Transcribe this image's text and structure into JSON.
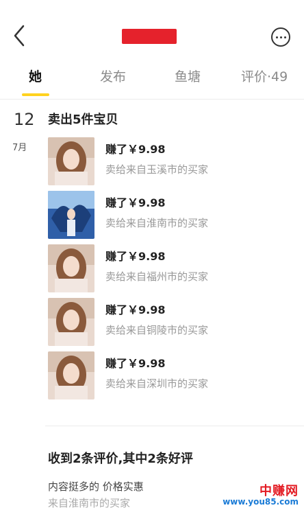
{
  "header": {
    "title_redacted": true
  },
  "tabs": [
    {
      "label": "她",
      "active": true
    },
    {
      "label": "发布"
    },
    {
      "label": "鱼塘"
    },
    {
      "label": "评价·49"
    }
  ],
  "timeline": {
    "day": "12",
    "month": "7月",
    "title": "卖出5件宝贝",
    "sales": [
      {
        "earned": "赚了￥9.98",
        "buyer": "卖给来自玉溪市的买家",
        "thumb": "portrait"
      },
      {
        "earned": "赚了￥9.98",
        "buyer": "卖给来自淮南市的买家",
        "thumb": "blue-anime"
      },
      {
        "earned": "赚了￥9.98",
        "buyer": "卖给来自福州市的买家",
        "thumb": "portrait"
      },
      {
        "earned": "赚了￥9.98",
        "buyer": "卖给来自铜陵市的买家",
        "thumb": "portrait"
      },
      {
        "earned": "赚了￥9.98",
        "buyer": "卖给来自深圳市的买家",
        "thumb": "portrait"
      }
    ]
  },
  "reviews": {
    "title": "收到2条评价,其中2条好评",
    "text": "内容挺多的 价格实惠",
    "source": "来自淮南市的买家"
  },
  "watermark": {
    "name": "中赚网",
    "url": "www.you85.com"
  },
  "colors": {
    "tab_underline": "#ffd21f",
    "redaction": "#e5222c",
    "watermark_red": "#e31b23"
  }
}
